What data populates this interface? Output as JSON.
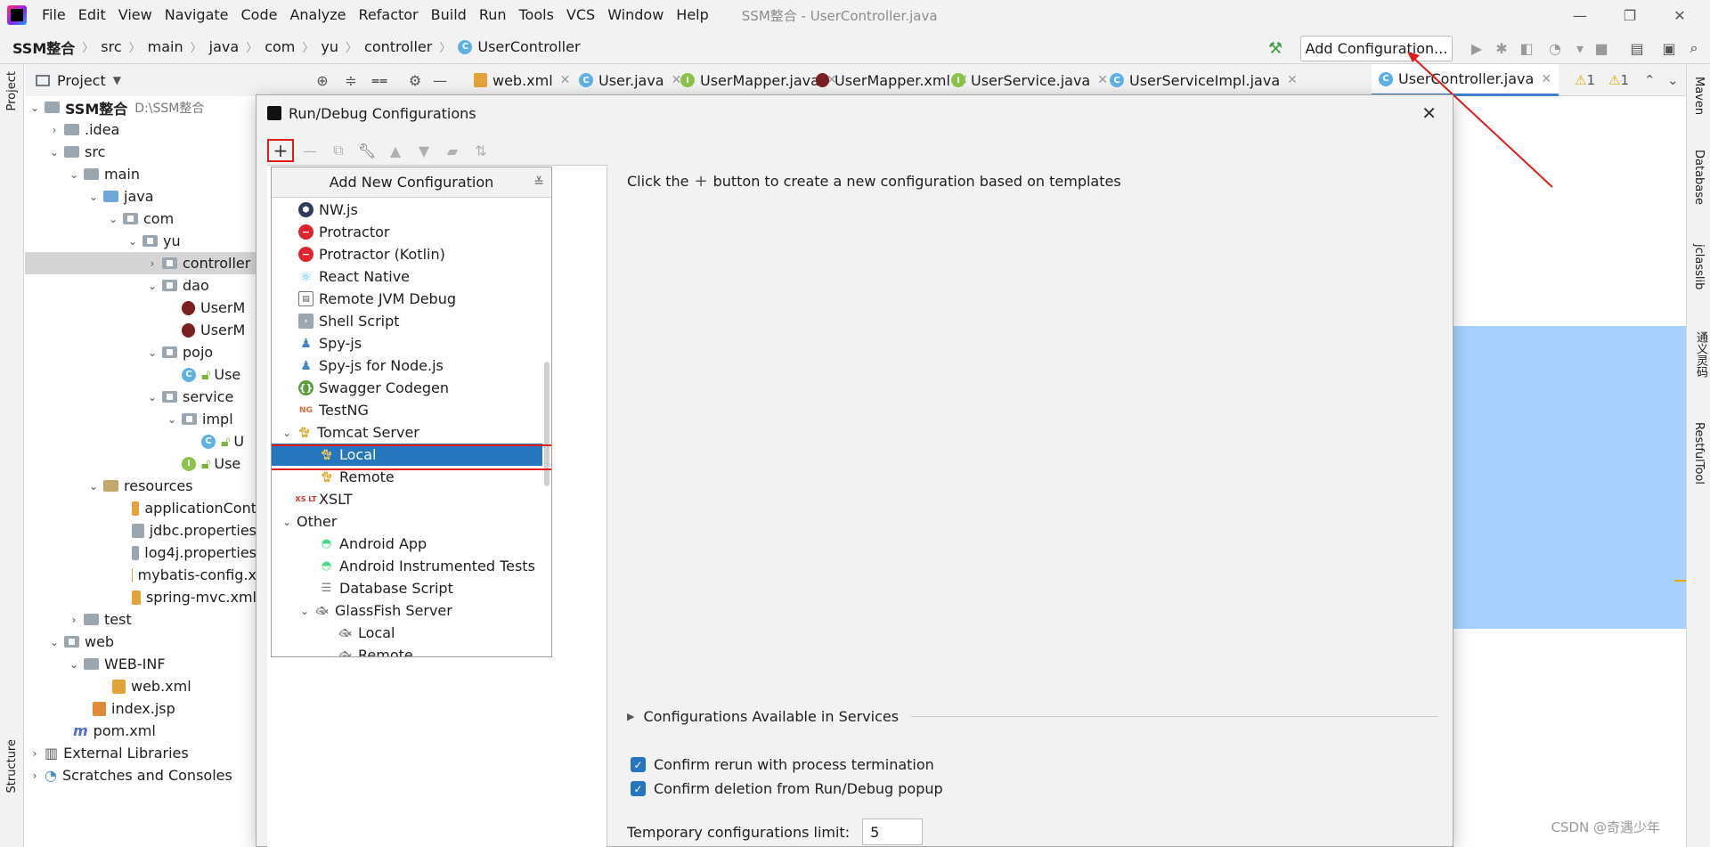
{
  "menubar": {
    "items": [
      "File",
      "Edit",
      "View",
      "Navigate",
      "Code",
      "Analyze",
      "Refactor",
      "Build",
      "Run",
      "Tools",
      "VCS",
      "Window",
      "Help"
    ],
    "window_title": "SSM整合 - UserController.java"
  },
  "breadcrumb": [
    "SSM整合",
    "src",
    "main",
    "java",
    "com",
    "yu",
    "controller",
    "UserController"
  ],
  "toolbar": {
    "add_configuration": "Add Configuration..."
  },
  "project_panel": {
    "title": "Project"
  },
  "tabs": [
    "web.xml",
    "User.java",
    "UserMapper.java",
    "UserMapper.xml",
    "UserService.java",
    "UserServiceImpl.java",
    "UserController.java"
  ],
  "tree": [
    {
      "label": "SSM整合",
      "path": "D:\\SSM整合"
    },
    {
      "label": ".idea"
    },
    {
      "label": "src"
    },
    {
      "label": "main"
    },
    {
      "label": "java"
    },
    {
      "label": "com"
    },
    {
      "label": "yu"
    },
    {
      "label": "controller"
    },
    {
      "label": "dao"
    },
    {
      "label": "UserM"
    },
    {
      "label": "UserM"
    },
    {
      "label": "pojo"
    },
    {
      "label": "Use"
    },
    {
      "label": "service"
    },
    {
      "label": "impl"
    },
    {
      "label": "U"
    },
    {
      "label": "Use"
    },
    {
      "label": "resources"
    },
    {
      "label": "applicationCont"
    },
    {
      "label": "jdbc.properties"
    },
    {
      "label": "log4j.properties"
    },
    {
      "label": "mybatis-config.x"
    },
    {
      "label": "spring-mvc.xml"
    },
    {
      "label": "test"
    },
    {
      "label": "web"
    },
    {
      "label": "WEB-INF"
    },
    {
      "label": "web.xml"
    },
    {
      "label": "index.jsp"
    },
    {
      "label": "pom.xml"
    },
    {
      "label": "External Libraries"
    },
    {
      "label": "Scratches and Consoles"
    }
  ],
  "dialog": {
    "title": "Run/Debug Configurations",
    "popup_header": "Add New Configuration",
    "items": [
      {
        "label": "NW.js"
      },
      {
        "label": "Protractor"
      },
      {
        "label": "Protractor (Kotlin)"
      },
      {
        "label": "React Native"
      },
      {
        "label": "Remote JVM Debug"
      },
      {
        "label": "Shell Script"
      },
      {
        "label": "Spy-js"
      },
      {
        "label": "Spy-js for Node.js"
      },
      {
        "label": "Swagger Codegen"
      },
      {
        "label": "TestNG"
      },
      {
        "label": "Tomcat Server"
      },
      {
        "label": "Local"
      },
      {
        "label": "Remote"
      },
      {
        "label": "XSLT"
      },
      {
        "label": "Other"
      },
      {
        "label": "Android App"
      },
      {
        "label": "Android Instrumented Tests"
      },
      {
        "label": "Database Script"
      },
      {
        "label": "GlassFish Server"
      },
      {
        "label": "Local"
      },
      {
        "label": "Remote"
      }
    ],
    "hint_before": "Click the",
    "hint_after": "button to create a new configuration based on templates",
    "services_label": "Configurations Available in Services",
    "confirm_rerun": "Confirm rerun with process termination",
    "confirm_delete": "Confirm deletion from Run/Debug popup",
    "temp_limit_label": "Temporary configurations limit:",
    "temp_limit_value": "5"
  },
  "right_strip": [
    "Maven",
    "Database",
    "jclasslib",
    "通义灵码",
    "RestfulTool"
  ],
  "left_strip": [
    "Project",
    "Structure"
  ],
  "warnings": {
    "count1": "1",
    "count2": "1"
  },
  "watermark": "CSDN @奇遇少年",
  "colors": {
    "accent": "#2675bf",
    "highlight_box": "#e01c1c",
    "selection_blue": "#a8d1ff"
  }
}
